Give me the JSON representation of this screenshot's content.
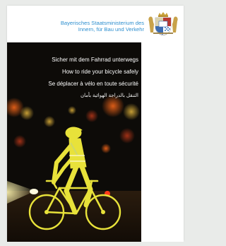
{
  "ministry": {
    "line1": "Bayerisches Staatsministerium des",
    "line2": "Innern, für Bau und Verkehr"
  },
  "titles": {
    "de": "Sicher mit dem Fahrrad unterwegs",
    "en": "How to ride your bicycle safely",
    "fr": "Se déplacer à vélo en toute sécurité",
    "ar": "التنقل بالدراجة الهوائية بأمان"
  },
  "colors": {
    "ministry_text": "#2e8fcf",
    "reflective_yellow": "#e8e23a",
    "background_night": "#0d0b08"
  },
  "icons": {
    "crest": "bavarian-coat-of-arms"
  }
}
